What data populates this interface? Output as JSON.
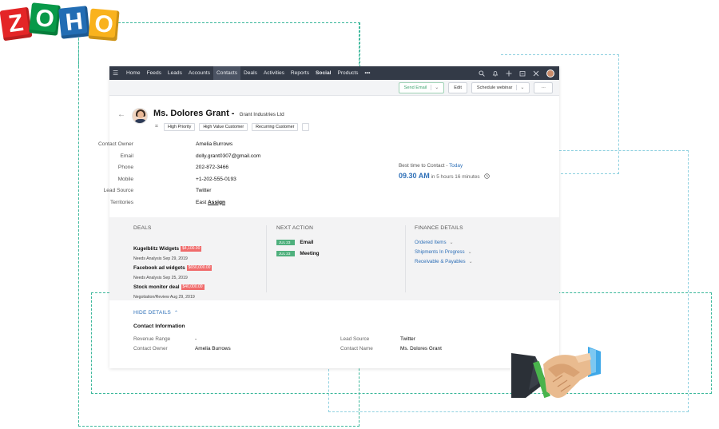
{
  "brand": {
    "letters": [
      {
        "char": "Z",
        "color": "#e42527"
      },
      {
        "char": "O",
        "color": "#089949"
      },
      {
        "char": "H",
        "color": "#226db4"
      },
      {
        "char": "O",
        "color": "#f9b21d"
      }
    ]
  },
  "colors": {
    "dash_green": "#3ab79a",
    "dash_blue": "#8fd1e0",
    "nav_bg": "#333a47",
    "accent_blue": "#2d6fb7",
    "badge_red": "#f06b6b",
    "badge_green": "#4fb07d"
  },
  "nav": {
    "menu_icon": "hamburger-icon",
    "items": [
      {
        "label": "Home"
      },
      {
        "label": "Feeds"
      },
      {
        "label": "Leads"
      },
      {
        "label": "Accounts"
      },
      {
        "label": "Contacts",
        "active": true
      },
      {
        "label": "Deals"
      },
      {
        "label": "Activities"
      },
      {
        "label": "Reports"
      },
      {
        "label": "Social",
        "bold": true
      },
      {
        "label": "Products"
      },
      {
        "label": "•••"
      }
    ],
    "right_icons": [
      "search-icon",
      "bell-icon",
      "plus-icon",
      "calendar-icon",
      "tools-icon",
      "user-avatar"
    ]
  },
  "toolbar": {
    "send_email": "Send Email",
    "send_email_caret": "⌄",
    "edit": "Edit",
    "schedule_webinar": "Schedule webinar",
    "schedule_caret": "⌄",
    "more": "···"
  },
  "contact": {
    "back": "←",
    "name": "Ms. Dolores Grant",
    "separator": " - ",
    "company": "Grant Industries Ltd",
    "tags": [
      "High Priority",
      "High Value Customer",
      "Recurring Customer"
    ],
    "fields": [
      {
        "label": "Contact Owner",
        "value": "Amelia Burrows"
      },
      {
        "label": "Email",
        "value": "dolly.grant0307@gmail.com"
      },
      {
        "label": "Phone",
        "value": "202-872-3466"
      },
      {
        "label": "Mobile",
        "value": "+1-202-555-0193"
      },
      {
        "label": "Lead Source",
        "value": "Twitter"
      },
      {
        "label": "Territories",
        "value": "East",
        "link": "Assign"
      }
    ],
    "best_time": {
      "label": "Best time to Contact - ",
      "day": "Today",
      "time": "09.30 AM",
      "remaining": " in 5 hours 16 minutes"
    }
  },
  "deals": {
    "heading": "DEALS",
    "items": [
      {
        "name": "Kugelblitz Widgets",
        "amount": "$4,100.00",
        "sub": "Needs Analysis Sep 29, 2019"
      },
      {
        "name": "Facebook ad widgets",
        "amount": "$650,000.00",
        "sub": "Needs Analysis Sep 25, 2019"
      },
      {
        "name": "Stock monitor deal",
        "amount": "$40,000.00",
        "sub": "Negotiation/Review Aug 29, 2019"
      }
    ]
  },
  "next_action": {
    "heading": "NEXT ACTION",
    "items": [
      {
        "date": "JUL 23",
        "label": "Email"
      },
      {
        "date": "JUL 23",
        "label": "Meeting"
      }
    ]
  },
  "finance": {
    "heading": "FINANCE DETAILS",
    "items": [
      "Ordered Items",
      "Shipments In Progress",
      "Receivable & Payables"
    ]
  },
  "details": {
    "toggle": "HIDE DETAILS",
    "toggle_caret": "⌃",
    "section_title": "Contact Information",
    "left": [
      {
        "label": "Revenue Range",
        "value": "-"
      },
      {
        "label": "Contact Owner",
        "value": "Amelia Burrows"
      }
    ],
    "right": [
      {
        "label": "Lead Source",
        "value": "Twitter"
      },
      {
        "label": "Contact Name",
        "value": "Ms. Dolores Grant"
      }
    ]
  }
}
